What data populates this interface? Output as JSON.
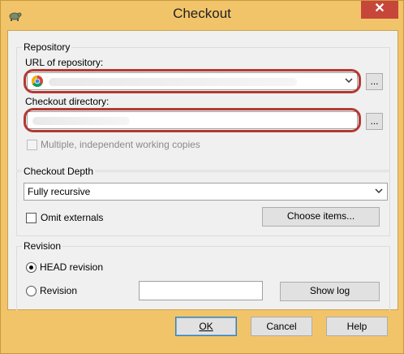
{
  "window": {
    "title": "Checkout",
    "close_glyph": "✕"
  },
  "repository": {
    "group_title": "Repository",
    "url_label": "URL of repository:",
    "url_value": "",
    "url_browse_label": "...",
    "dir_label": "Checkout directory:",
    "dir_value": "",
    "dir_browse_label": "...",
    "multiple_label": "Multiple, independent working copies"
  },
  "depth": {
    "group_title": "Checkout Depth",
    "selected": "Fully recursive",
    "omit_externals_label": "Omit externals",
    "choose_items_label": "Choose items..."
  },
  "revision": {
    "group_title": "Revision",
    "head_label": "HEAD revision",
    "revision_label": "Revision",
    "revision_value": "",
    "show_log_label": "Show log"
  },
  "footer": {
    "ok_label": "OK",
    "cancel_label": "Cancel",
    "help_label": "Help"
  },
  "colors": {
    "title_bar": "#f2c46a",
    "close_button": "#c7463a",
    "highlight": "#b23a33"
  }
}
